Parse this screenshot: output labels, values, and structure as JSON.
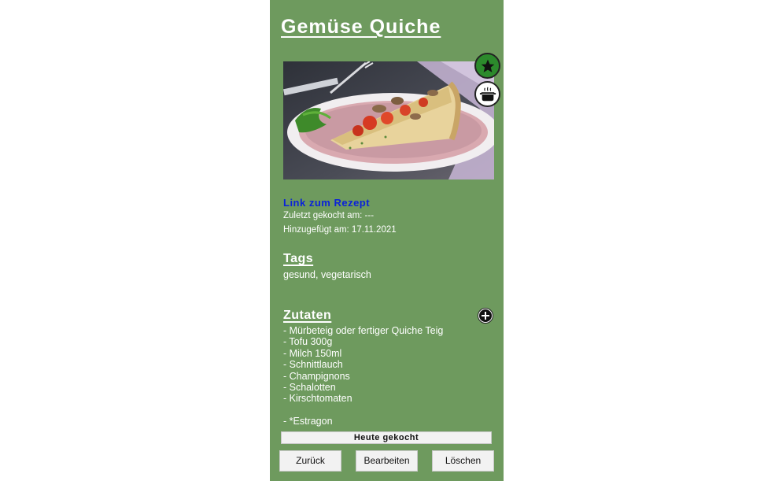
{
  "recipe": {
    "title": "Gemüse Quiche",
    "link_label": "Link zum Rezept",
    "last_cooked": "Zuletzt gekocht am: ---",
    "added": "Hinzugefügt am: 17.11.2021"
  },
  "tags": {
    "heading": "Tags",
    "text": "gesund, vegetarisch"
  },
  "ingredients": {
    "heading": "Zutaten",
    "items": [
      "- Mürbeteig oder fertiger Quiche Teig",
      "- Tofu 300g",
      "- Milch 150ml",
      "- Schnittlauch",
      "- Champignons",
      "- Schalotten",
      "- Kirschtomaten",
      "",
      "- *Estragon"
    ]
  },
  "buttons": {
    "cooked_today": "Heute gekocht",
    "back": "Zurück",
    "edit": "Bearbeiten",
    "delete": "Löschen"
  },
  "icons": {
    "favorite": "star-icon",
    "cook": "cooking-pot-icon",
    "add": "plus-icon"
  },
  "colors": {
    "background": "#6e9a5e",
    "favorite_button": "#2c8a2c",
    "link": "#0a22d8"
  }
}
